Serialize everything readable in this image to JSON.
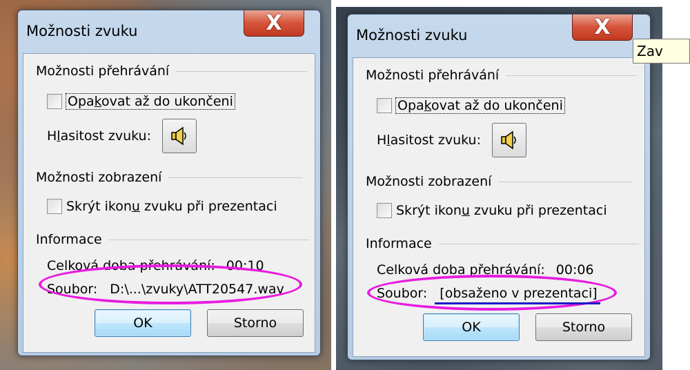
{
  "dialogs": [
    {
      "title": "Možnosti zvuku",
      "close_label": "X",
      "group_playback": "Možnosti přehrávání",
      "loop_pre": "Opa",
      "loop_u": "k",
      "loop_post": "ovat až do ukončeni",
      "volume_pre": "H",
      "volume_u": "l",
      "volume_post": "asitost zvuku:",
      "group_display": "Možnosti zobrazení",
      "hide_pre": "Skrýt ikon",
      "hide_u": "u",
      "hide_post": " zvuku při prezentaci",
      "group_info": "Informace",
      "duration_label": "Celková doba přehrávání:",
      "duration_value": "00:10",
      "file_label": "Soubor:",
      "file_value": "D:\\...\\zvuky\\ATT20547.wav",
      "ok_label": "OK",
      "cancel_label": "Storno"
    },
    {
      "title": "Možnosti zvuku",
      "close_label": "X",
      "group_playback": "Možnosti přehrávání",
      "loop_pre": "Opa",
      "loop_u": "k",
      "loop_post": "ovat až do ukončeni",
      "volume_pre": "H",
      "volume_u": "l",
      "volume_post": "asitost zvuku:",
      "group_display": "Možnosti zobrazení",
      "hide_pre": "Skrýt ikon",
      "hide_u": "u",
      "hide_post": " zvuku při prezentaci",
      "group_info": "Informace",
      "duration_label": "Celková doba přehrávání:",
      "duration_value": "00:06",
      "file_label": "Soubor:",
      "file_value": "[obsaženo v prezentaci]",
      "ok_label": "OK",
      "cancel_label": "Storno"
    }
  ],
  "tooltip": "Zav",
  "icons": {
    "volume": "speaker-icon",
    "close": "close-icon"
  },
  "colors": {
    "annotation": "#e81be0",
    "underline": "#1a18c8",
    "close": "#c03a22"
  }
}
